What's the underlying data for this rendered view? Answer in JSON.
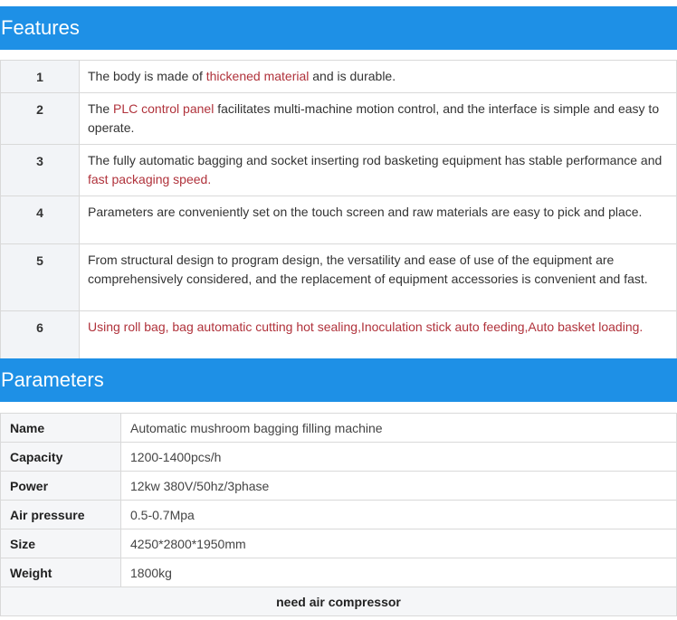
{
  "features": {
    "title": "Features",
    "rows": [
      {
        "num": "1",
        "parts": [
          {
            "text": "The body is made of ",
            "hl": false
          },
          {
            "text": "thickened material",
            "hl": true
          },
          {
            "text": " and is durable.",
            "hl": false
          }
        ]
      },
      {
        "num": "2",
        "parts": [
          {
            "text": "The ",
            "hl": false
          },
          {
            "text": "PLC control panel",
            "hl": true
          },
          {
            "text": " facilitates multi-machine motion control, and the interface is simple and easy to operate.",
            "hl": false
          }
        ]
      },
      {
        "num": "3",
        "parts": [
          {
            "text": "The fully automatic bagging and socket inserting rod basketing equipment has stable performance and ",
            "hl": false
          },
          {
            "text": "fast packaging speed.",
            "hl": true
          }
        ]
      },
      {
        "num": "4",
        "parts": [
          {
            "text": "Parameters are conveniently set on the touch screen and raw materials are easy to pick and place.",
            "hl": false
          }
        ]
      },
      {
        "num": "5",
        "parts": [
          {
            "text": "From structural design to program design, the versatility and ease of use of the equipment are comprehensively considered, and the replacement of equipment accessories is convenient and fast.",
            "hl": false
          }
        ]
      },
      {
        "num": "6",
        "parts": [
          {
            "text": "Using roll bag, bag automatic cutting hot sealing,Inoculation stick auto feeding,Auto basket loading.",
            "hl": true
          }
        ]
      }
    ]
  },
  "parameters": {
    "title": "Parameters",
    "rows": [
      {
        "key": "Name",
        "value": "Automatic mushroom bagging filling machine"
      },
      {
        "key": "Capacity",
        "value": "1200-1400pcs/h"
      },
      {
        "key": "Power",
        "value": "12kw 380V/50hz/3phase"
      },
      {
        "key": "Air pressure",
        "value": "0.5-0.7Mpa"
      },
      {
        "key": "Size",
        "value": "4250*2800*1950mm"
      },
      {
        "key": "Weight",
        "value": "1800kg"
      }
    ],
    "note": "need air compressor"
  },
  "colors": {
    "banner": "#1e90e6",
    "highlight": "#b0323b"
  }
}
